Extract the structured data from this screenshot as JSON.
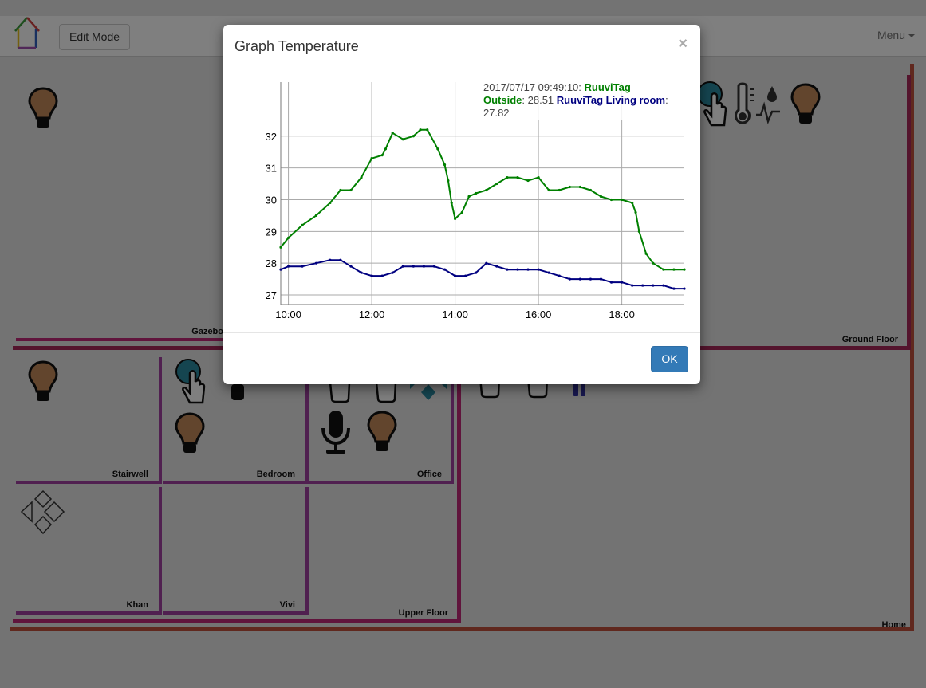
{
  "toolbar": {
    "edit_mode": "Edit Mode",
    "menu": "Menu"
  },
  "rooms": {
    "gazebo": "Gazebo",
    "ground_floor": "Ground Floor",
    "stairwell": "Stairwell",
    "bedroom": "Bedroom",
    "office": "Office",
    "khan": "Khan",
    "vivi": "Vivi",
    "upper_floor": "Upper Floor",
    "home": "Home"
  },
  "colors": {
    "home": "#c0503c",
    "ground_floor": "#a8285a",
    "upper_floor": "#c02878",
    "room": "#a040a0",
    "bulb": "#c48a5a",
    "teal": "#2a8aa0"
  },
  "modal": {
    "title": "Graph Temperature",
    "close": "×",
    "ok": "OK",
    "legend": {
      "timestamp": "2017/07/17 09:49:10:",
      "series1_name": "RuuviTag Outside",
      "series1_value": ": 28.51",
      "series2_name": "RuuviTag Living room",
      "series2_value": ": 27.82"
    }
  },
  "chart_data": {
    "type": "line",
    "title": "",
    "xlabel": "",
    "ylabel": "",
    "xlim": [
      "09:49",
      "19:30"
    ],
    "ylim": [
      26.7,
      33.7
    ],
    "x_ticks": [
      "10:00",
      "12:00",
      "14:00",
      "16:00",
      "18:00"
    ],
    "y_ticks": [
      27,
      28,
      29,
      30,
      31,
      32
    ],
    "grid": true,
    "legend_position": "top-right",
    "series": [
      {
        "name": "RuuviTag Outside",
        "color": "#008000",
        "x": [
          "09:49",
          "10:00",
          "10:20",
          "10:40",
          "11:00",
          "11:15",
          "11:30",
          "11:45",
          "12:00",
          "12:15",
          "12:20",
          "12:30",
          "12:45",
          "13:00",
          "13:10",
          "13:20",
          "13:35",
          "13:45",
          "13:50",
          "13:55",
          "14:00",
          "14:10",
          "14:20",
          "14:30",
          "14:45",
          "15:00",
          "15:15",
          "15:30",
          "15:45",
          "16:00",
          "16:15",
          "16:30",
          "16:45",
          "17:00",
          "17:15",
          "17:30",
          "17:45",
          "18:00",
          "18:15",
          "18:20",
          "18:25",
          "18:35",
          "18:45",
          "19:00",
          "19:15",
          "19:30"
        ],
        "y": [
          28.5,
          28.8,
          29.2,
          29.5,
          29.9,
          30.3,
          30.3,
          30.7,
          31.3,
          31.4,
          31.6,
          32.1,
          31.9,
          32.0,
          32.2,
          32.2,
          31.6,
          31.1,
          30.6,
          29.9,
          29.4,
          29.6,
          30.1,
          30.2,
          30.3,
          30.5,
          30.7,
          30.7,
          30.6,
          30.7,
          30.3,
          30.3,
          30.4,
          30.4,
          30.3,
          30.1,
          30.0,
          30.0,
          29.9,
          29.6,
          29.0,
          28.3,
          28.0,
          27.8,
          27.8,
          27.8
        ]
      },
      {
        "name": "RuuviTag Living room",
        "color": "#000080",
        "x": [
          "09:49",
          "10:00",
          "10:20",
          "10:40",
          "11:00",
          "11:15",
          "11:30",
          "11:45",
          "12:00",
          "12:15",
          "12:30",
          "12:45",
          "13:00",
          "13:15",
          "13:30",
          "13:45",
          "14:00",
          "14:15",
          "14:30",
          "14:45",
          "15:00",
          "15:15",
          "15:30",
          "15:45",
          "16:00",
          "16:15",
          "16:30",
          "16:45",
          "17:00",
          "17:15",
          "17:30",
          "17:45",
          "18:00",
          "18:15",
          "18:30",
          "18:45",
          "19:00",
          "19:15",
          "19:30"
        ],
        "y": [
          27.8,
          27.9,
          27.9,
          28.0,
          28.1,
          28.1,
          27.9,
          27.7,
          27.6,
          27.6,
          27.7,
          27.9,
          27.9,
          27.9,
          27.9,
          27.8,
          27.6,
          27.6,
          27.7,
          28.0,
          27.9,
          27.8,
          27.8,
          27.8,
          27.8,
          27.7,
          27.6,
          27.5,
          27.5,
          27.5,
          27.5,
          27.4,
          27.4,
          27.3,
          27.3,
          27.3,
          27.3,
          27.2,
          27.2
        ]
      }
    ]
  }
}
